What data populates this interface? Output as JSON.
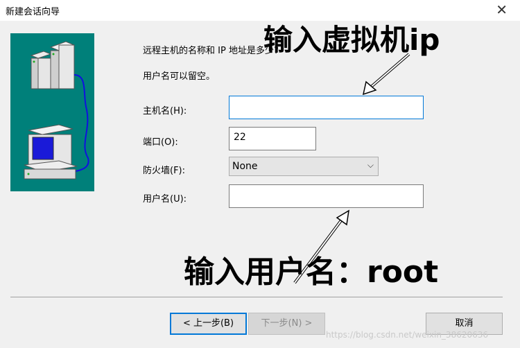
{
  "window": {
    "title": "新建会话向导"
  },
  "intro": {
    "line1": "远程主机的名称和 IP 地址是多少?",
    "line2": "用户名可以留空。"
  },
  "form": {
    "hostname_label": "主机名(H):",
    "hostname_value": "",
    "port_label": "端口(O):",
    "port_value": "22",
    "firewall_label": "防火墙(F):",
    "firewall_value": "None",
    "username_label": "用户名(U):",
    "username_value": ""
  },
  "annotations": {
    "top": "输入虚拟机ip",
    "bottom": "输入用户名：root"
  },
  "buttons": {
    "back": "< 上一步(B)",
    "next": "下一步(N) >",
    "cancel": "取消"
  },
  "watermark": "https://blog.csdn.net/weixin_38620636",
  "icons": {
    "close": "close-icon",
    "servers": "servers-icon",
    "computer": "computer-icon"
  },
  "colors": {
    "panel_bg": "#00807a",
    "focus_border": "#0078d7"
  }
}
